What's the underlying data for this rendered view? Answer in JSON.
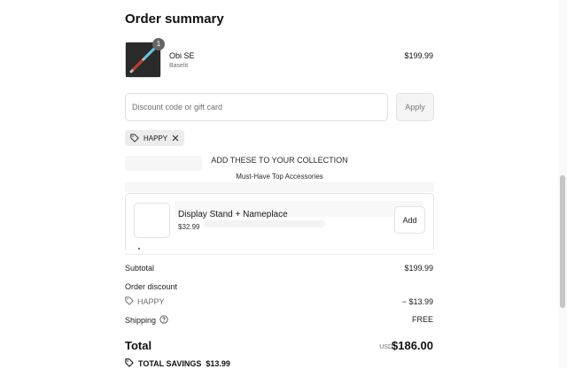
{
  "summary": {
    "title": "Order summary",
    "product": {
      "name": "Obi SE",
      "variant": "Baselit",
      "price": "$199.99",
      "quantity": "1"
    },
    "discount": {
      "placeholder": "Discount code or gift card",
      "apply_label": "Apply",
      "applied_code": "HAPPY"
    },
    "upsell": {
      "heading": "ADD THESE TO YOUR COLLECTION",
      "subheading": "Must-Have Top Accessories",
      "item": {
        "name": "Display Stand + Nameplace",
        "price": "$32.99",
        "add_label": "Add"
      }
    },
    "totals": {
      "subtotal_label": "Subtotal",
      "subtotal_value": "$199.99",
      "order_discount_label": "Order discount",
      "discount_code": "HAPPY",
      "discount_value": "− $13.99",
      "shipping_label": "Shipping",
      "shipping_value": "FREE",
      "total_label": "Total",
      "currency": "USD",
      "total_value": "$186.00",
      "savings_label": "TOTAL SAVINGS",
      "savings_value": "$13.99"
    }
  },
  "icons": {
    "tag": "tag-icon",
    "close": "close-icon",
    "help": "help-circle-icon"
  }
}
